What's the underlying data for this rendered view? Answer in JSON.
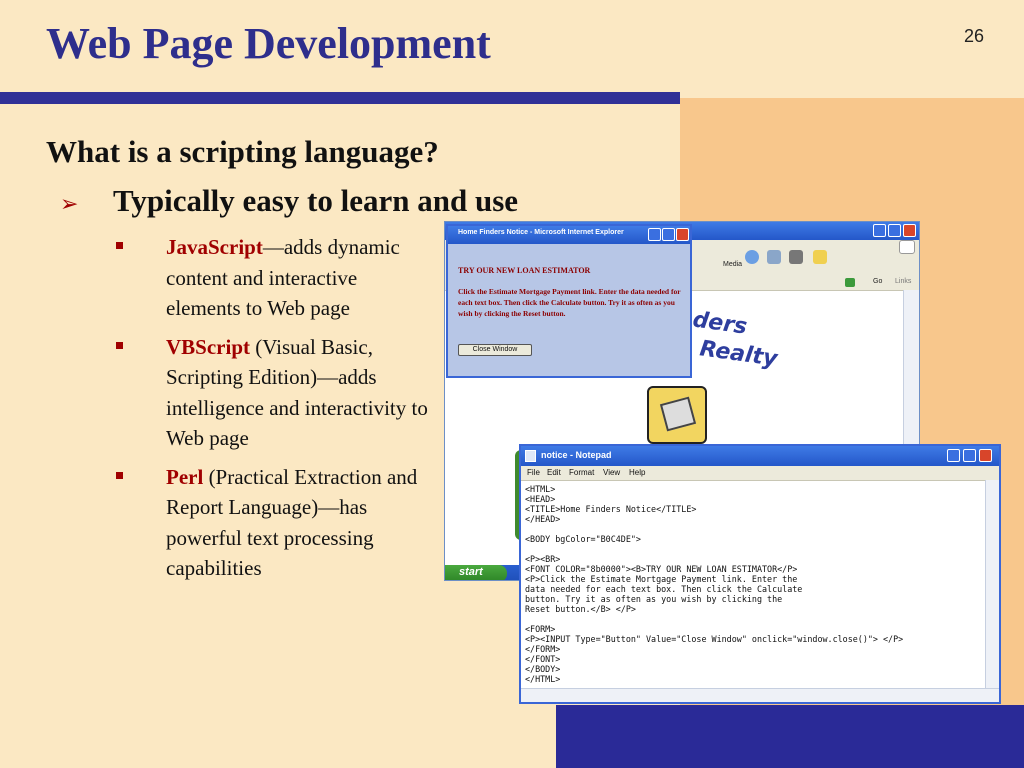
{
  "slide": {
    "title": "Web Page Development",
    "number": "26",
    "heading": "What is a scripting language?",
    "sub_heading": "Typically easy to learn and use",
    "bullets": [
      {
        "term": "JavaScript",
        "text": "—adds dynamic content and interactive elements to Web page"
      },
      {
        "term": "VBScript",
        "text": " (Visual Basic, Scripting Edition)—adds intelligence and interactivity to Web page"
      },
      {
        "term": "Perl",
        "text": " (Practical Extraction and Report Language)—has powerful text processing capabilities"
      }
    ]
  },
  "browser": {
    "toolbar_media": "Media",
    "go": "Go",
    "links": "Links",
    "page_heading_line1": "nders",
    "page_heading_line2": "e Realty",
    "start": "start"
  },
  "dialog": {
    "title": "Home Finders Notice - Microsoft Internet Explorer",
    "heading": "TRY OUR NEW LOAN ESTIMATOR",
    "body": "Click the Estimate Mortgage Payment link. Enter the data needed for each text box. Then click the Calculate button. Try it as often as you wish by clicking the Reset button.",
    "button": "Close Window"
  },
  "notepad": {
    "title": "notice - Notepad",
    "menu": [
      "File",
      "Edit",
      "Format",
      "View",
      "Help"
    ],
    "text": "<HTML>\n<HEAD>\n<TITLE>Home Finders Notice</TITLE>\n</HEAD>\n\n<BODY bgColor=\"B0C4DE\">\n\n<P><BR>\n<FONT COLOR=\"8b0000\"><B>TRY OUR NEW LOAN ESTIMATOR</P>\n<P>Click the Estimate Mortgage Payment link. Enter the\ndata needed for each text box. Then click the Calculate\nbutton. Try it as often as you wish by clicking the\nReset button.</B> </P>\n\n<FORM>\n<P><INPUT Type=\"Button\" Value=\"Close Window\" onclick=\"window.close()\"> </P>\n</FORM>\n</FONT>\n</BODY>\n</HTML>"
  }
}
